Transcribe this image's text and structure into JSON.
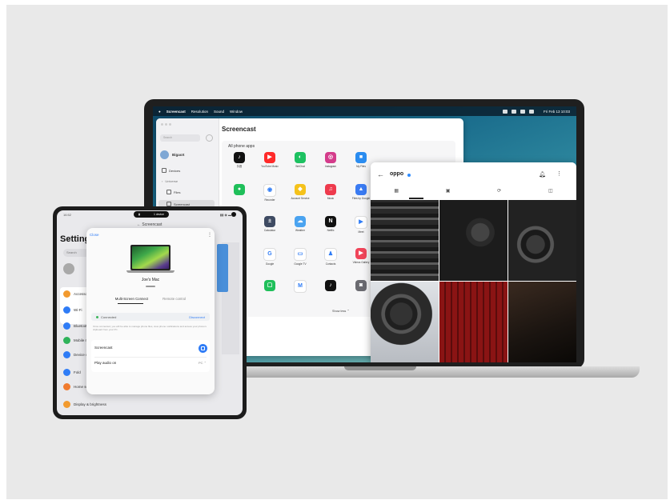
{
  "laptop": {
    "menubar": {
      "app": "Screencast",
      "items": [
        "Resolution",
        "Sound",
        "Window"
      ],
      "clock": "Fri Feb 13 10:03"
    },
    "window": {
      "title": "Screencast",
      "search_placeholder": "Search",
      "user": "BigaoX",
      "sidebar": [
        "Devices",
        "Universe",
        "Files",
        "Screencast"
      ],
      "section": "All phone apps",
      "apps": [
        {
          "label": "抖音",
          "color": "#111111",
          "glyph": "♪"
        },
        {
          "label": "YouTube Music",
          "color": "#ff2a2a",
          "glyph": "▶"
        },
        {
          "label": "WeChat",
          "color": "#1dc161",
          "glyph": "◐"
        },
        {
          "label": "Instagram",
          "color": "#d43c8b",
          "glyph": "◎"
        },
        {
          "label": "My Files",
          "color": "#2a8cf0",
          "glyph": "■"
        },
        {
          "label": "",
          "color": "#1fbf5a",
          "glyph": "●"
        },
        {
          "label": "Recorder",
          "color": "#ffffff",
          "glyph": "◉"
        },
        {
          "label": "Account Service",
          "color": "#f5c21b",
          "glyph": "◆"
        },
        {
          "label": "Music",
          "color": "#ee3a4d",
          "glyph": "♫"
        },
        {
          "label": "Files by Google",
          "color": "#3a7bf2",
          "glyph": "▲"
        },
        {
          "label": "",
          "color": "#333355",
          "glyph": "◼"
        },
        {
          "label": "Calculator",
          "color": "#3f4b63",
          "glyph": "±"
        },
        {
          "label": "Weather",
          "color": "#4aa3f0",
          "glyph": "☁"
        },
        {
          "label": "Netflix",
          "color": "#111111",
          "glyph": "N"
        },
        {
          "label": "Meet",
          "color": "#ffffff",
          "glyph": "▶"
        },
        {
          "label": "",
          "color": "#ffffff",
          "glyph": ""
        },
        {
          "label": "Google",
          "color": "#ffffff",
          "glyph": "G"
        },
        {
          "label": "Google TV",
          "color": "#ffffff",
          "glyph": "▭"
        },
        {
          "label": "Contacts",
          "color": "#ffffff",
          "glyph": "♟"
        },
        {
          "label": "Videos Gallery",
          "color": "#f0455a",
          "glyph": "▶"
        },
        {
          "label": "",
          "color": "#ffffff",
          "glyph": ""
        },
        {
          "label": "",
          "color": "#1fbf5a",
          "glyph": "▢"
        },
        {
          "label": "",
          "color": "#ffffff",
          "glyph": "M"
        },
        {
          "label": "",
          "color": "#111111",
          "glyph": "♪"
        },
        {
          "label": "",
          "color": "#6a6a70",
          "glyph": "◙"
        }
      ],
      "show_less": "Show less"
    },
    "gallery": {
      "name": "oppo",
      "tabs": [
        "▦",
        "▣",
        "⟳",
        "◫"
      ]
    }
  },
  "phone": {
    "status_time": "16:52",
    "pill_text": "1 device",
    "status_right": "▮▮ ◉ ▬",
    "header": "Screencast",
    "settings_title": "Settings",
    "search_placeholder": "Search",
    "rows": [
      "Accessories & more",
      "Wi-Fi",
      "Bluetooth",
      "Mobile network",
      "Device connections",
      "Fold",
      "Home screen & lock screen",
      "Display & brightness"
    ],
    "dialog": {
      "close": "Close",
      "device_name": "Joe's Mac",
      "tab_multi": "Multi-Screen Connect",
      "tab_remote": "Remote control",
      "connected": "Connected",
      "disconnect": "Disconnect",
      "note": "Once connected, you will be able to manage phone files, view phone notifications and access your phone's clipboard from your PC.",
      "screencast": "Screencast",
      "play_audio": "Play audio on",
      "play_audio_value": "PC ⌃"
    }
  },
  "colors": {
    "accent": "#2f7cf6",
    "desktop": "#1a6c8c"
  }
}
